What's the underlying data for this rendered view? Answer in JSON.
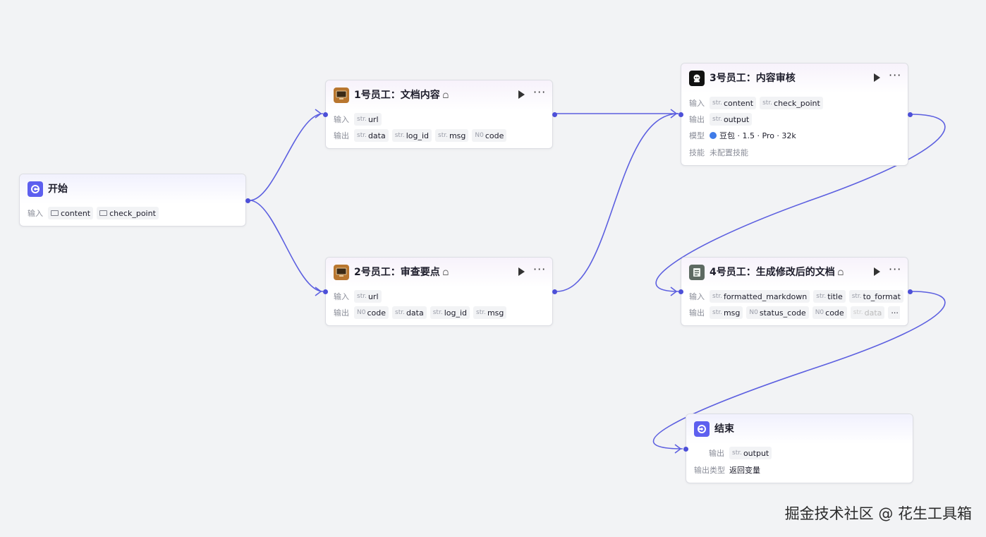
{
  "nodes": {
    "start": {
      "title": "开始",
      "input_label": "输入",
      "inputs": [
        "content",
        "check_point"
      ]
    },
    "emp1": {
      "title": "1号员工：文档内容",
      "badge": "ᗝ",
      "input_label": "输入",
      "output_label": "输出",
      "inputs": [
        {
          "type": "str.",
          "name": "url"
        }
      ],
      "outputs": [
        {
          "type": "str.",
          "name": "data"
        },
        {
          "type": "str.",
          "name": "log_id"
        },
        {
          "type": "str.",
          "name": "msg"
        },
        {
          "type": "N0",
          "name": "code"
        }
      ]
    },
    "emp2": {
      "title": "2号员工：审查要点",
      "badge": "ᗝ",
      "input_label": "输入",
      "output_label": "输出",
      "inputs": [
        {
          "type": "str.",
          "name": "url"
        }
      ],
      "outputs": [
        {
          "type": "N0",
          "name": "code"
        },
        {
          "type": "str.",
          "name": "data"
        },
        {
          "type": "str.",
          "name": "log_id"
        },
        {
          "type": "str.",
          "name": "msg"
        }
      ]
    },
    "emp3": {
      "title": "3号员工：内容审核",
      "input_label": "输入",
      "output_label": "输出",
      "model_label": "模型",
      "skill_label": "技能",
      "inputs": [
        {
          "type": "str.",
          "name": "content"
        },
        {
          "type": "str.",
          "name": "check_point"
        }
      ],
      "outputs": [
        {
          "type": "str.",
          "name": "output"
        }
      ],
      "model": "豆包 · 1.5 · Pro · 32k",
      "skill": "未配置技能"
    },
    "emp4": {
      "title": "4号员工：生成修改后的文档",
      "badge": "ᗝ",
      "input_label": "输入",
      "output_label": "输出",
      "inputs": [
        {
          "type": "str.",
          "name": "formatted_markdown"
        },
        {
          "type": "str.",
          "name": "title"
        },
        {
          "type": "str.",
          "name": "to_format"
        }
      ],
      "outputs": [
        {
          "type": "str.",
          "name": "msg"
        },
        {
          "type": "N0",
          "name": "status_code"
        },
        {
          "type": "N0",
          "name": "code"
        },
        {
          "type": "str.",
          "name": "data"
        }
      ],
      "overflow": "···"
    },
    "end": {
      "title": "结束",
      "output_label": "输出",
      "outputs": [
        {
          "type": "str.",
          "name": "output"
        }
      ],
      "output_type_label": "输出类型",
      "output_type": "返回变量"
    }
  },
  "controls": {
    "run_icon": "play-icon",
    "more": "···"
  },
  "colors": {
    "accent": "#5d5fef",
    "edge": "#5c5fe0",
    "tool": "#b8762f"
  },
  "watermark": "掘金技术社区 @ 花生工具箱"
}
